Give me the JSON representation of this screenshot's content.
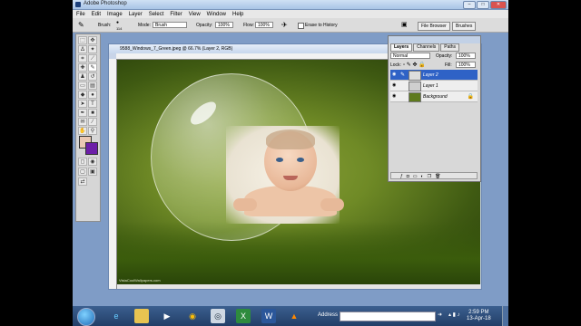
{
  "window": {
    "title": "Adobe Photoshop"
  },
  "menu": [
    "File",
    "Edit",
    "Image",
    "Layer",
    "Select",
    "Filter",
    "View",
    "Window",
    "Help"
  ],
  "options": {
    "brush_label": "Brush:",
    "brush_size": "114",
    "mode_label": "Mode:",
    "mode_value": "Brush",
    "opacity_label": "Opacity:",
    "opacity_value": "100%",
    "flow_label": "Flow:",
    "flow_value": "100%",
    "erase_label": "Erase to History",
    "palette_tabs": [
      "File Browser",
      "Brushes"
    ]
  },
  "document": {
    "title": "9588_Windows_7_Green.jpeg @ 66.7% (Layer 2, RGB)",
    "watermark": "VistaCoolWallpapers.com"
  },
  "layers_panel": {
    "tabs": [
      "Layers",
      "Channels",
      "Paths"
    ],
    "blend_mode": "Normal",
    "opacity_label": "Opacity:",
    "opacity_value": "100%",
    "lock_label": "Lock:",
    "fill_label": "Fill:",
    "fill_value": "100%",
    "layers": [
      "Layer 2",
      "Layer 1",
      "Background"
    ]
  },
  "taskbar": {
    "address_label": "Address",
    "time": "2:59 PM",
    "date": "13-Apr-18"
  },
  "colors": {
    "selection": "#2f62c6",
    "canvas_green": "#6f8a26"
  }
}
